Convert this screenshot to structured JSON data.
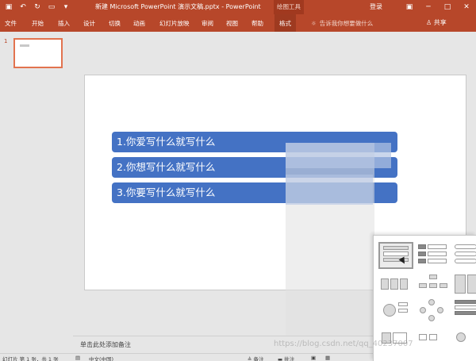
{
  "titlebar": {
    "doc_title": "新建 Microsoft PowerPoint 演示文稿.pptx - PowerPoint",
    "tool_label": "绘图工具",
    "login": "登录",
    "qat_icons": [
      "save-icon",
      "undo-icon",
      "redo-icon",
      "present-icon",
      "dropdown-icon"
    ]
  },
  "ribbon": {
    "tabs": [
      "文件",
      "开始",
      "插入",
      "设计",
      "切换",
      "动画",
      "幻灯片放映",
      "审阅",
      "视图",
      "帮助",
      "格式"
    ],
    "active_tab": "格式",
    "search_placeholder": "告诉我你想要做什么",
    "share": "共享"
  },
  "thumbnails": {
    "number": "1"
  },
  "slide": {
    "bars": [
      "1.你爱写什么就写什么",
      "2.你想写什么就写什么",
      "3.你要写什么就写什么"
    ],
    "bar_color": "#4472c4"
  },
  "notes": {
    "placeholder": "单击此处添加备注"
  },
  "statusbar": {
    "slide_info": "幻灯片 第 1 张，共 1 张",
    "language": "中文(中国)",
    "notes_btn": "备注",
    "comments_btn": "批注"
  },
  "watermark": "https://blog.csdn.net/qq_40237007",
  "colors": {
    "accent": "#b7472a",
    "active_tab": "#9e3a20"
  }
}
